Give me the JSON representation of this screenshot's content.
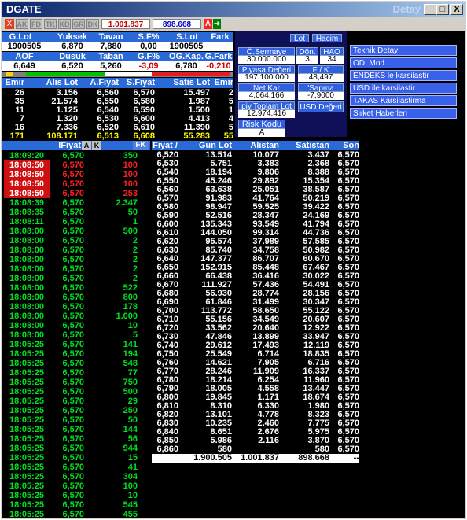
{
  "window": {
    "title": "DGATE",
    "right_title": "Detay",
    "btn_min": "_",
    "btn_max": "□",
    "btn_close": "X"
  },
  "toolbar": {
    "close": "X",
    "tabs": [
      "AK",
      "FD",
      "TK",
      "KD",
      "GR",
      "DK"
    ],
    "value1": "1.001.837",
    "value2": "898.668",
    "a_label": "A"
  },
  "summary": {
    "h1": [
      "G.Lot",
      "Yuksek",
      "Tavan",
      "S.F%",
      "S.Lot",
      "Fark"
    ],
    "v1": [
      "1900505",
      "6,870",
      "7,880",
      "0,00",
      "1900505",
      ""
    ],
    "h2": [
      "AOF",
      "Dusuk",
      "Taban",
      "G.F%",
      "OG.Kap.",
      "G.Fark"
    ],
    "v2": [
      "6,649",
      "6,520",
      "5,260",
      "-3,09",
      "6,780",
      "-0,210"
    ]
  },
  "panel": {
    "labels": {
      "sermaye": "Ö.Sermaye",
      "don": "Dön.",
      "hao": "HAO",
      "piyasa": "Piyasa Değeri",
      "fk": "F / K",
      "netkar": "Net Kar",
      "sapma": "'Sapma",
      "toplam": "piy.Toplam Lot",
      "usd": "USD Değeri",
      "risk": "Risk Kodu",
      "lot": "Lot",
      "hacim": "Hacim"
    },
    "values": {
      "sermaye": "30.000.000",
      "don": "3",
      "hao": "34",
      "piyasa": "197.100.000",
      "fk": "48,497",
      "netkar": "4.064.166",
      "sapma": "-7,9000",
      "toplam": "12.974.416",
      "risk": "A"
    }
  },
  "menu": [
    "Teknik Detay",
    "OD. Mod.",
    "ENDEKS le karsilastir",
    "USD ile karsilastir",
    "TAKAS Karsilastirma",
    "Sirket Haberleri"
  ],
  "depth": {
    "headers": [
      "Emir",
      "Alis Lot",
      "A.Fiyat",
      "S.Fiyat",
      "Satis Lot",
      "Emir"
    ],
    "rows": [
      [
        "26",
        "3.156",
        "6,560",
        "6,570",
        "15.497",
        "2"
      ],
      [
        "35",
        "21.574",
        "6,550",
        "6,580",
        "1.987",
        "5"
      ],
      [
        "11",
        "1.125",
        "6,540",
        "6,590",
        "1.500",
        "1"
      ],
      [
        "7",
        "1.320",
        "6,530",
        "6,600",
        "4.413",
        "4"
      ],
      [
        "16",
        "7.336",
        "6,520",
        "6,610",
        "11.390",
        "5"
      ]
    ],
    "total": [
      "171",
      "108.171",
      "6,513",
      "6,608",
      "55.283",
      "55"
    ]
  },
  "trades": {
    "header_fiyat": "IFiyat",
    "hdr_a": "A",
    "hdr_k": "K",
    "hdr_fk": "FK",
    "rows": [
      [
        "18:09:20",
        "6,570",
        "350",
        "g"
      ],
      [
        "18:08:50",
        "6,570",
        "100",
        "r"
      ],
      [
        "18:08:50",
        "6,570",
        "100",
        "r"
      ],
      [
        "18:08:50",
        "6,570",
        "100",
        "r"
      ],
      [
        "18:08:50",
        "6,570",
        "253",
        "r"
      ],
      [
        "18:08:39",
        "6,570",
        "2.347",
        "g"
      ],
      [
        "18:08:35",
        "6,570",
        "50",
        "g"
      ],
      [
        "18:08:11",
        "6,570",
        "1",
        "g"
      ],
      [
        "18:08:00",
        "6,570",
        "500",
        "g"
      ],
      [
        "18:08:00",
        "6,570",
        "2",
        "g"
      ],
      [
        "18:08:00",
        "6,570",
        "2",
        "g"
      ],
      [
        "18:08:00",
        "6,570",
        "2",
        "g"
      ],
      [
        "18:08:00",
        "6,570",
        "2",
        "g"
      ],
      [
        "18:08:00",
        "6,570",
        "2",
        "g"
      ],
      [
        "18:08:00",
        "6,570",
        "522",
        "g"
      ],
      [
        "18:08:00",
        "6,570",
        "800",
        "g"
      ],
      [
        "18:08:00",
        "6,570",
        "178",
        "g"
      ],
      [
        "18:08:00",
        "6,570",
        "1.000",
        "g"
      ],
      [
        "18:08:00",
        "6,570",
        "10",
        "g"
      ],
      [
        "18:08:00",
        "6,570",
        "5",
        "g"
      ],
      [
        "18:05:25",
        "6,570",
        "141",
        "g"
      ],
      [
        "18:05:25",
        "6,570",
        "194",
        "g"
      ],
      [
        "18:05:25",
        "6,570",
        "548",
        "g"
      ],
      [
        "18:05:25",
        "6,570",
        "77",
        "g"
      ],
      [
        "18:05:25",
        "6,570",
        "750",
        "g"
      ],
      [
        "18:05:25",
        "6,570",
        "500",
        "g"
      ],
      [
        "18:05:25",
        "6,570",
        "29",
        "g"
      ],
      [
        "18:05:25",
        "6,570",
        "250",
        "g"
      ],
      [
        "18:05:25",
        "6,570",
        "50",
        "g"
      ],
      [
        "18:05:25",
        "6,570",
        "144",
        "g"
      ],
      [
        "18:05:25",
        "6,570",
        "56",
        "g"
      ],
      [
        "18:05:25",
        "6,570",
        "944",
        "g"
      ],
      [
        "18:05:25",
        "6,570",
        "15",
        "g"
      ],
      [
        "18:05:25",
        "6,570",
        "41",
        "g"
      ],
      [
        "18:05:25",
        "6,570",
        "304",
        "g"
      ],
      [
        "18:05:25",
        "6,570",
        "100",
        "g"
      ],
      [
        "18:05:25",
        "6,570",
        "10",
        "g"
      ],
      [
        "18:05:25",
        "6,570",
        "545",
        "g"
      ],
      [
        "18:05:25",
        "6,570",
        "455",
        "g"
      ]
    ]
  },
  "volume": {
    "headers": [
      "Fiyat",
      "Gun Lot",
      "Alistan",
      "Satistan",
      "Son"
    ],
    "rows": [
      [
        "6,520",
        "13.514",
        "10.077",
        "3.437",
        "6,570"
      ],
      [
        "6,530",
        "5.751",
        "3.383",
        "2.368",
        "6,570"
      ],
      [
        "6,540",
        "18.194",
        "9.806",
        "8.388",
        "6,570"
      ],
      [
        "6,550",
        "45.246",
        "29.892",
        "15.354",
        "6,570"
      ],
      [
        "6,560",
        "63.638",
        "25.051",
        "38.587",
        "6,570"
      ],
      [
        "6,570",
        "91.983",
        "41.764",
        "50.219",
        "6,570"
      ],
      [
        "6,580",
        "98.947",
        "59.525",
        "39.422",
        "6,570"
      ],
      [
        "6,590",
        "52.516",
        "28.347",
        "24.169",
        "6,570"
      ],
      [
        "6,600",
        "135.343",
        "93.549",
        "41.794",
        "6,570"
      ],
      [
        "6,610",
        "144.050",
        "99.314",
        "44.736",
        "6,570"
      ],
      [
        "6,620",
        "95.574",
        "37.989",
        "57.585",
        "6,570"
      ],
      [
        "6,630",
        "85.740",
        "34.758",
        "50.982",
        "6,570"
      ],
      [
        "6,640",
        "147.377",
        "86.707",
        "60.670",
        "6,570"
      ],
      [
        "6,650",
        "152.915",
        "85.448",
        "67.467",
        "6,570"
      ],
      [
        "6,660",
        "66.438",
        "36.416",
        "30.022",
        "6,570"
      ],
      [
        "6,670",
        "111.927",
        "57.436",
        "54.491",
        "6,570"
      ],
      [
        "6,680",
        "56.930",
        "28.774",
        "28.156",
        "6,570"
      ],
      [
        "6,690",
        "61.846",
        "31.499",
        "30.347",
        "6,570"
      ],
      [
        "6,700",
        "113.772",
        "58.650",
        "55.122",
        "6,570"
      ],
      [
        "6,710",
        "55.156",
        "34.549",
        "20.607",
        "6,570"
      ],
      [
        "6,720",
        "33.562",
        "20.640",
        "12.922",
        "6,570"
      ],
      [
        "6,730",
        "47.846",
        "13.899",
        "33.947",
        "6,570"
      ],
      [
        "6,740",
        "29.612",
        "17.493",
        "12.119",
        "6,570"
      ],
      [
        "6,750",
        "25.549",
        "6.714",
        "18.835",
        "6,570"
      ],
      [
        "6,760",
        "14.621",
        "7.905",
        "6.716",
        "6,570"
      ],
      [
        "6,770",
        "28.246",
        "11.909",
        "16.337",
        "6,570"
      ],
      [
        "6,780",
        "18.214",
        "6.254",
        "11.960",
        "6,570"
      ],
      [
        "6,790",
        "18.005",
        "4.558",
        "13.447",
        "6,570"
      ],
      [
        "6,800",
        "19.845",
        "1.171",
        "18.674",
        "6,570"
      ],
      [
        "6,810",
        "8.310",
        "6.330",
        "1.980",
        "6,570"
      ],
      [
        "6,820",
        "13.101",
        "4.778",
        "8.323",
        "6,570"
      ],
      [
        "6,830",
        "10.235",
        "2.460",
        "7.775",
        "6,570"
      ],
      [
        "6,840",
        "8.651",
        "2.676",
        "5.975",
        "6,570"
      ],
      [
        "6,850",
        "5.986",
        "2.116",
        "3.870",
        "6,570"
      ],
      [
        "6,860",
        "580",
        "",
        "580",
        "6,570"
      ]
    ],
    "total": [
      "",
      "1.900.505",
      "1.001.837",
      "898.668",
      "--"
    ]
  }
}
